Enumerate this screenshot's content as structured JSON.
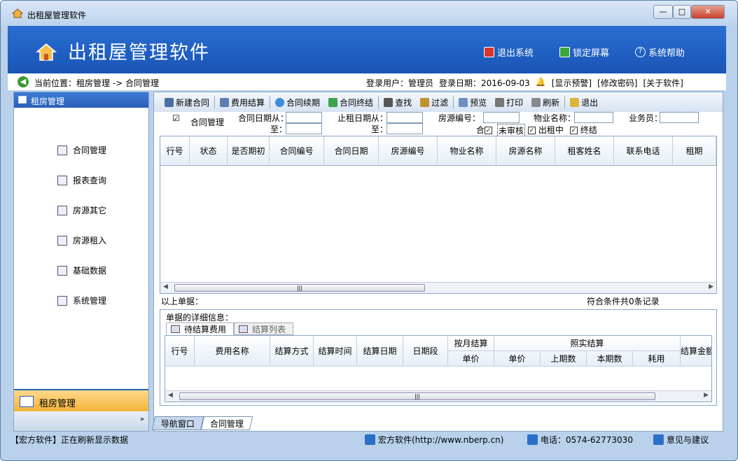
{
  "window": {
    "title": "出租屋管理软件"
  },
  "header": {
    "app_title": "出租屋管理软件",
    "buttons": [
      {
        "label": "退出系统",
        "icon": "exit-icon",
        "color": "#d9352b"
      },
      {
        "label": "锁定屏幕",
        "icon": "lock-screen-icon",
        "color": "#3da53b"
      },
      {
        "label": "系统帮助",
        "icon": "help-icon",
        "color": "#ffffff"
      }
    ]
  },
  "location": {
    "text": "当前位置：租房管理 -> 合同管理",
    "user": "登录用户：管理员",
    "date": "登录日期：2016-09-03",
    "alerts": "[显示预警]",
    "change_pwd": "[修改密码]",
    "about": "[关于软件]"
  },
  "sidebar": {
    "header": "租房管理",
    "items": [
      {
        "label": "合同管理",
        "icon": "contract-icon"
      },
      {
        "label": "报表查询",
        "icon": "report-icon"
      },
      {
        "label": "房源其它",
        "icon": "house-other-icon"
      },
      {
        "label": "房源租入",
        "icon": "house-rent-in-icon"
      },
      {
        "label": "基础数据",
        "icon": "base-data-icon"
      },
      {
        "label": "系统管理",
        "icon": "system-icon"
      }
    ],
    "bottom_label": "租房管理"
  },
  "toolbar": {
    "items": [
      {
        "label": "新建合同",
        "icon": "new-contract-icon",
        "color": "#4a6fa5"
      },
      {
        "label": "费用结算",
        "icon": "fee-settle-icon",
        "color": "#5a7fb0"
      },
      {
        "label": "合同续期",
        "icon": "renew-icon",
        "color": "#3d8bd9"
      },
      {
        "label": "合同终结",
        "icon": "terminate-icon",
        "color": "#3aa34b"
      },
      {
        "label": "查找",
        "icon": "find-icon",
        "color": "#555555"
      },
      {
        "label": "过滤",
        "icon": "filter-icon",
        "color": "#c0902e"
      },
      {
        "label": "预览",
        "icon": "preview-icon",
        "color": "#6c8fc0"
      },
      {
        "label": "打印",
        "icon": "print-icon",
        "color": "#777777"
      },
      {
        "label": "刷新",
        "icon": "refresh-icon",
        "color": "#888888"
      },
      {
        "label": "退出",
        "icon": "exit-folder-icon",
        "color": "#e0b33a"
      }
    ]
  },
  "filters": {
    "section_label": "合同管理",
    "date_from_label": "合同日期从：",
    "date_to_label": "至：",
    "end_from_label": "止租日期从：",
    "end_to_label": "至：",
    "house_no_label": "房源编号：",
    "property_label": "物业名称：",
    "staff_label": "业务员：",
    "checks": [
      {
        "label": "合",
        "checked": true
      },
      {
        "label": "未审核",
        "checked": false
      },
      {
        "label": "出租中",
        "checked": true
      },
      {
        "label": "终结",
        "checked": true
      }
    ]
  },
  "contracts_table": {
    "columns": [
      "行号",
      "状态",
      "是否期初",
      "合同编号",
      "合同日期",
      "房源编号",
      "物业名称",
      "房源名称",
      "租客姓名",
      "联系电话",
      "租期"
    ],
    "rows": []
  },
  "summary": {
    "left": "以上单据：",
    "right": "符合条件共0条记录"
  },
  "detail": {
    "title": "单据的详细信息：",
    "tabs": [
      {
        "label": "待结算费用",
        "active": true
      },
      {
        "label": "结算列表",
        "active": false
      }
    ],
    "columns": [
      "行号",
      "费用名称",
      "结算方式",
      "结算时间",
      "结算日期",
      "日期段"
    ],
    "group_monthly": "按月结算",
    "monthly_sub": [
      "单价"
    ],
    "group_actual": "照实结算",
    "actual_sub": [
      "单价",
      "上期数",
      "本期数",
      "耗用"
    ],
    "last_col": "结算金额"
  },
  "bottom_tabs": [
    {
      "label": "导航窗口",
      "active": false
    },
    {
      "label": "合同管理",
      "active": true
    }
  ],
  "statusbar": {
    "message": "【宏方软件】正在刷新显示数据",
    "company": "宏方软件(http://www.nberp.cn)",
    "phone": "电话：0574-62773030",
    "feedback": "意见与建议"
  }
}
